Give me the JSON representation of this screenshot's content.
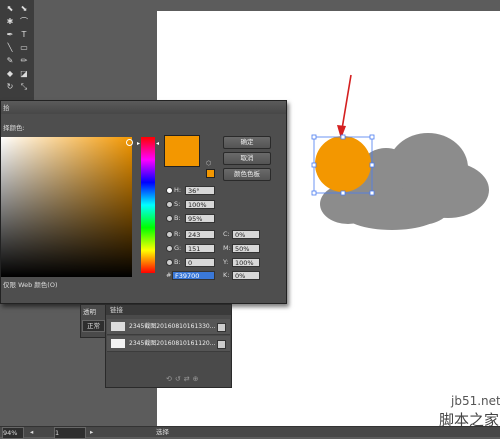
{
  "toolbar": {
    "tools": [
      "selection-tool",
      "direct-selection-tool",
      "magic-wand-tool",
      "lasso-tool",
      "pen-tool",
      "type-tool",
      "line-tool",
      "rectangle-tool",
      "paintbrush-tool",
      "pencil-tool",
      "blob-brush-tool",
      "eraser-tool",
      "rotate-tool",
      "scale-tool"
    ],
    "glyphs": [
      "⬉",
      "⬊",
      "✱",
      "⌒",
      "✒",
      "T",
      "╲",
      "▭",
      "✎",
      "✏",
      "◆",
      "◪",
      "↻",
      "⤡"
    ]
  },
  "color_picker": {
    "title": "拾",
    "select_color_label": "择颜色:",
    "ok_button": "确定",
    "cancel_button": "取消",
    "swatches_button": "颜色色板",
    "current_color": "#f39700",
    "hsb": {
      "h_label": "H:",
      "h_value": "36°",
      "s_label": "S:",
      "s_value": "100%",
      "b_label": "B:",
      "b_value": "95%"
    },
    "rgb": {
      "r_label": "R:",
      "r_value": "243",
      "g_label": "G:",
      "g_value": "151",
      "b_label": "B:",
      "b_value": "0"
    },
    "cmyk": {
      "c_label": "C:",
      "c_value": "0%",
      "m_label": "M:",
      "m_value": "50%",
      "y_label": "Y:",
      "y_value": "100%",
      "k_label": "K:",
      "k_value": "0%"
    },
    "hex_label": "#",
    "hex_value": "F39700",
    "web_only_label": "仅限 Web 颜色(O)"
  },
  "transparency_panel": {
    "tab_label": "透明",
    "mode": "正常"
  },
  "links_panel": {
    "tab_label": "链接",
    "items": [
      {
        "name": "2345截图20160810161330..."
      },
      {
        "name": "2345截图20160810161120..."
      }
    ]
  },
  "statusbar": {
    "zoom": "94%",
    "page": "1",
    "tool_label": "选择"
  },
  "artwork": {
    "sun_color": "#f39700",
    "cloud_color": "#8c8c8c",
    "arrow_color": "#d42020"
  },
  "watermark": {
    "site": "jb51.net",
    "name": "脚本之家"
  }
}
